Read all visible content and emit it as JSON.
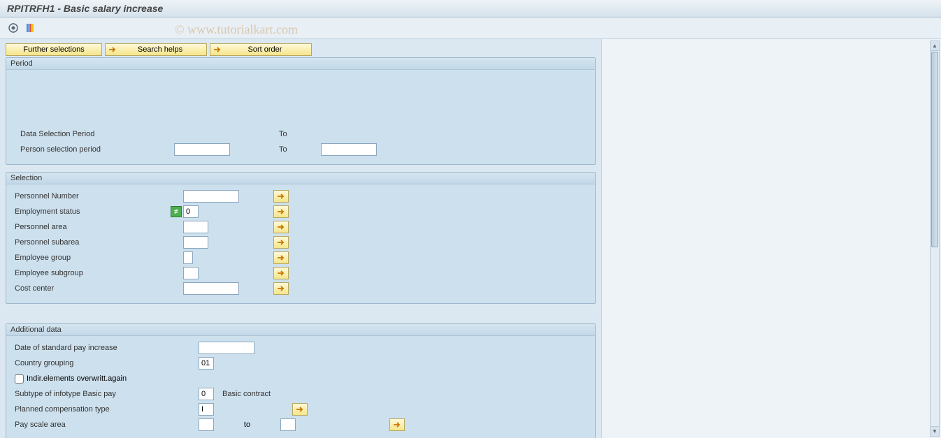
{
  "title": "RPITRFH1 - Basic salary increase",
  "watermark": "© www.tutorialkart.com",
  "buttons": {
    "further_selections": "Further selections",
    "search_helps": "Search helps",
    "sort_order": "Sort order"
  },
  "groups": {
    "period": {
      "title": "Period",
      "data_selection_label": "Data Selection Period",
      "person_selection_label": "Person selection period",
      "to_label": "To"
    },
    "selection": {
      "title": "Selection",
      "rows": [
        {
          "label": "Personnel Number",
          "input_class": "w80",
          "value": "",
          "arrow": true,
          "green": false
        },
        {
          "label": "Employment status",
          "input_class": "w25",
          "value": "0",
          "arrow": true,
          "green": true
        },
        {
          "label": "Personnel area",
          "input_class": "w40",
          "value": "",
          "arrow": true,
          "green": false
        },
        {
          "label": "Personnel subarea",
          "input_class": "w40",
          "value": "",
          "arrow": true,
          "green": false
        },
        {
          "label": "Employee group",
          "input_class": "w15",
          "value": "",
          "arrow": true,
          "green": false
        },
        {
          "label": "Employee subgroup",
          "input_class": "w25",
          "value": "",
          "arrow": true,
          "green": false
        },
        {
          "label": "Cost center",
          "input_class": "w80",
          "value": "",
          "arrow": true,
          "green": false
        }
      ]
    },
    "additional": {
      "title": "Additional data",
      "date_pay_increase_label": "Date of standard pay increase",
      "country_grouping_label": "Country grouping",
      "country_grouping_value": "01",
      "indir_checkbox_label": "Indir.elements overwritt.again",
      "subtype_label": "Subtype of infotype Basic pay",
      "subtype_value": "0",
      "subtype_desc": "Basic contract",
      "planned_comp_label": "Planned compensation type",
      "planned_comp_value": "I",
      "pay_scale_label": "Pay scale area",
      "to_label": "to"
    }
  }
}
